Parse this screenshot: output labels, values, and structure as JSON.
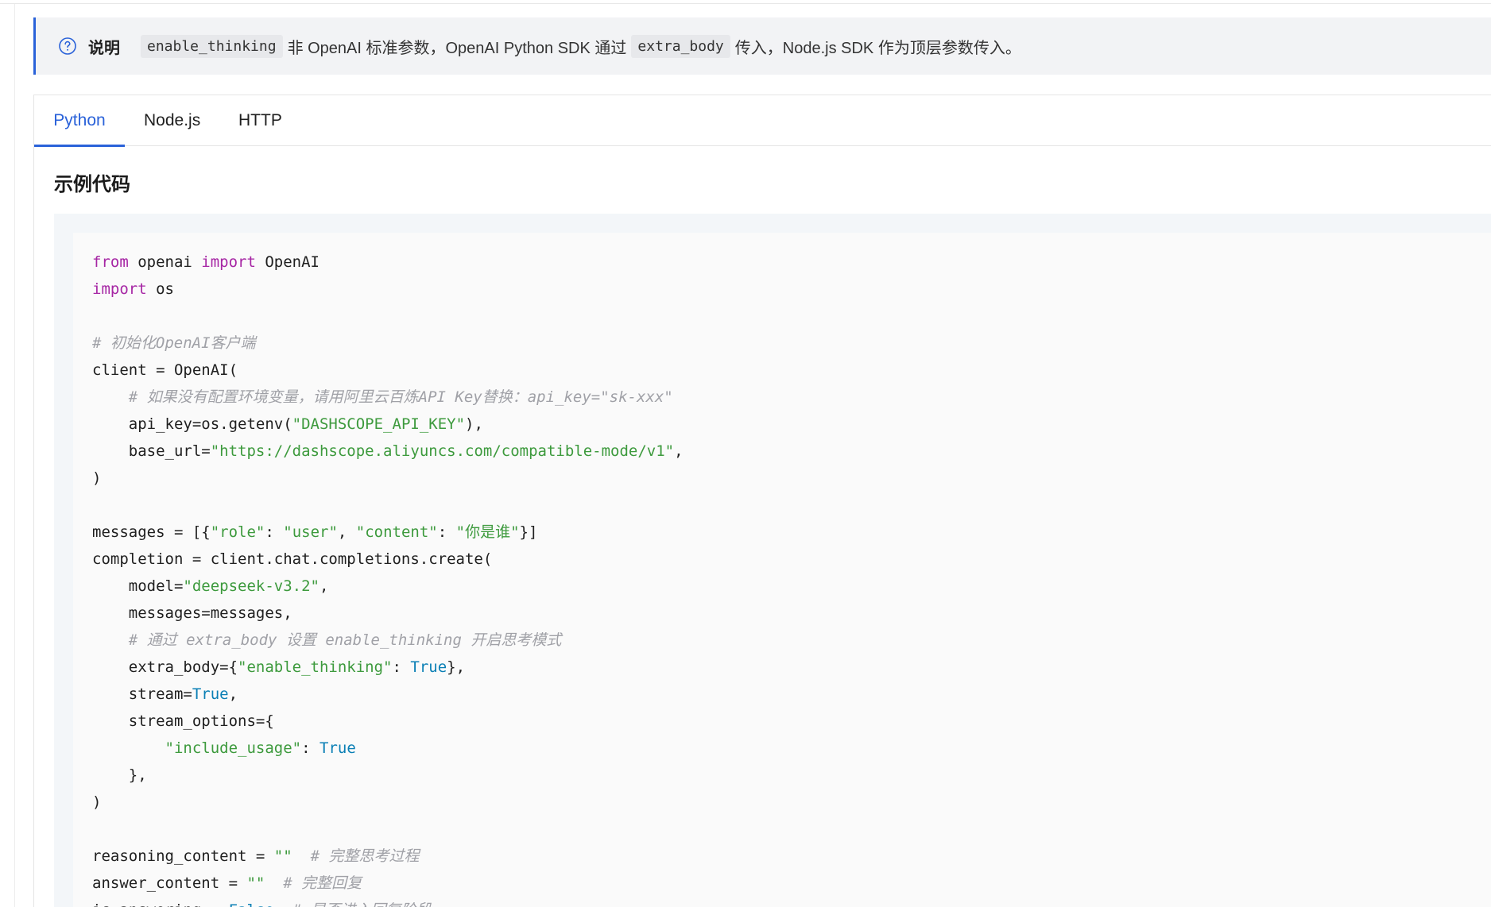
{
  "note": {
    "icon": "question-circle-icon",
    "label": "说明",
    "code1": "enable_thinking",
    "text1": "非 OpenAI 标准参数，OpenAI Python SDK 通过",
    "code2": "extra_body",
    "text2": "传入，Node.js SDK 作为顶层参数传入。",
    "accent": "#2a62d9"
  },
  "tabs": [
    {
      "label": "Python",
      "active": true
    },
    {
      "label": "Node.js",
      "active": false
    },
    {
      "label": "HTTP",
      "active": false
    }
  ],
  "section_title": "示例代码",
  "code": [
    [
      [
        "kw",
        "from"
      ],
      [
        "p",
        " openai "
      ],
      [
        "kw",
        "import"
      ],
      [
        "p",
        " OpenAI"
      ]
    ],
    [
      [
        "kw",
        "import"
      ],
      [
        "p",
        " os"
      ]
    ],
    [],
    [
      [
        "cm",
        "# 初始化OpenAI客户端"
      ]
    ],
    [
      [
        "p",
        "client = OpenAI("
      ]
    ],
    [
      [
        "p",
        "    "
      ],
      [
        "cm",
        "# 如果没有配置环境变量，请用阿里云百炼API Key替换：api_key=\"sk-xxx\""
      ]
    ],
    [
      [
        "p",
        "    api_key=os.getenv("
      ],
      [
        "str",
        "\"DASHSCOPE_API_KEY\""
      ],
      [
        "p",
        "),"
      ]
    ],
    [
      [
        "p",
        "    base_url="
      ],
      [
        "str",
        "\"https://dashscope.aliyuncs.com/compatible-mode/v1\""
      ],
      [
        "p",
        ","
      ]
    ],
    [
      [
        "p",
        ")"
      ]
    ],
    [],
    [
      [
        "p",
        "messages = [{"
      ],
      [
        "str",
        "\"role\""
      ],
      [
        "p",
        ": "
      ],
      [
        "str",
        "\"user\""
      ],
      [
        "p",
        ", "
      ],
      [
        "str",
        "\"content\""
      ],
      [
        "p",
        ": "
      ],
      [
        "str",
        "\"你是谁\""
      ],
      [
        "p",
        "}]"
      ]
    ],
    [
      [
        "p",
        "completion = client.chat.completions.create("
      ]
    ],
    [
      [
        "p",
        "    model="
      ],
      [
        "str",
        "\"deepseek-v3.2\""
      ],
      [
        "p",
        ","
      ]
    ],
    [
      [
        "p",
        "    messages=messages,"
      ]
    ],
    [
      [
        "p",
        "    "
      ],
      [
        "cm",
        "# 通过 extra_body 设置 enable_thinking 开启思考模式"
      ]
    ],
    [
      [
        "p",
        "    extra_body={"
      ],
      [
        "str",
        "\"enable_thinking\""
      ],
      [
        "p",
        ": "
      ],
      [
        "bool",
        "True"
      ],
      [
        "p",
        "},"
      ]
    ],
    [
      [
        "p",
        "    stream="
      ],
      [
        "bool",
        "True"
      ],
      [
        "p",
        ","
      ]
    ],
    [
      [
        "p",
        "    stream_options={"
      ]
    ],
    [
      [
        "p",
        "        "
      ],
      [
        "str",
        "\"include_usage\""
      ],
      [
        "p",
        ": "
      ],
      [
        "bool",
        "True"
      ]
    ],
    [
      [
        "p",
        "    },"
      ]
    ],
    [
      [
        "p",
        ")"
      ]
    ],
    [],
    [
      [
        "p",
        "reasoning_content = "
      ],
      [
        "str",
        "\"\""
      ],
      [
        "p",
        "  "
      ],
      [
        "cm",
        "# 完整思考过程"
      ]
    ],
    [
      [
        "p",
        "answer_content = "
      ],
      [
        "str",
        "\"\""
      ],
      [
        "p",
        "  "
      ],
      [
        "cm",
        "# 完整回复"
      ]
    ],
    [
      [
        "p",
        "is_answering = "
      ],
      [
        "bool",
        "False"
      ],
      [
        "p",
        "  "
      ],
      [
        "cm",
        "# 是否进入回复阶段"
      ]
    ]
  ]
}
